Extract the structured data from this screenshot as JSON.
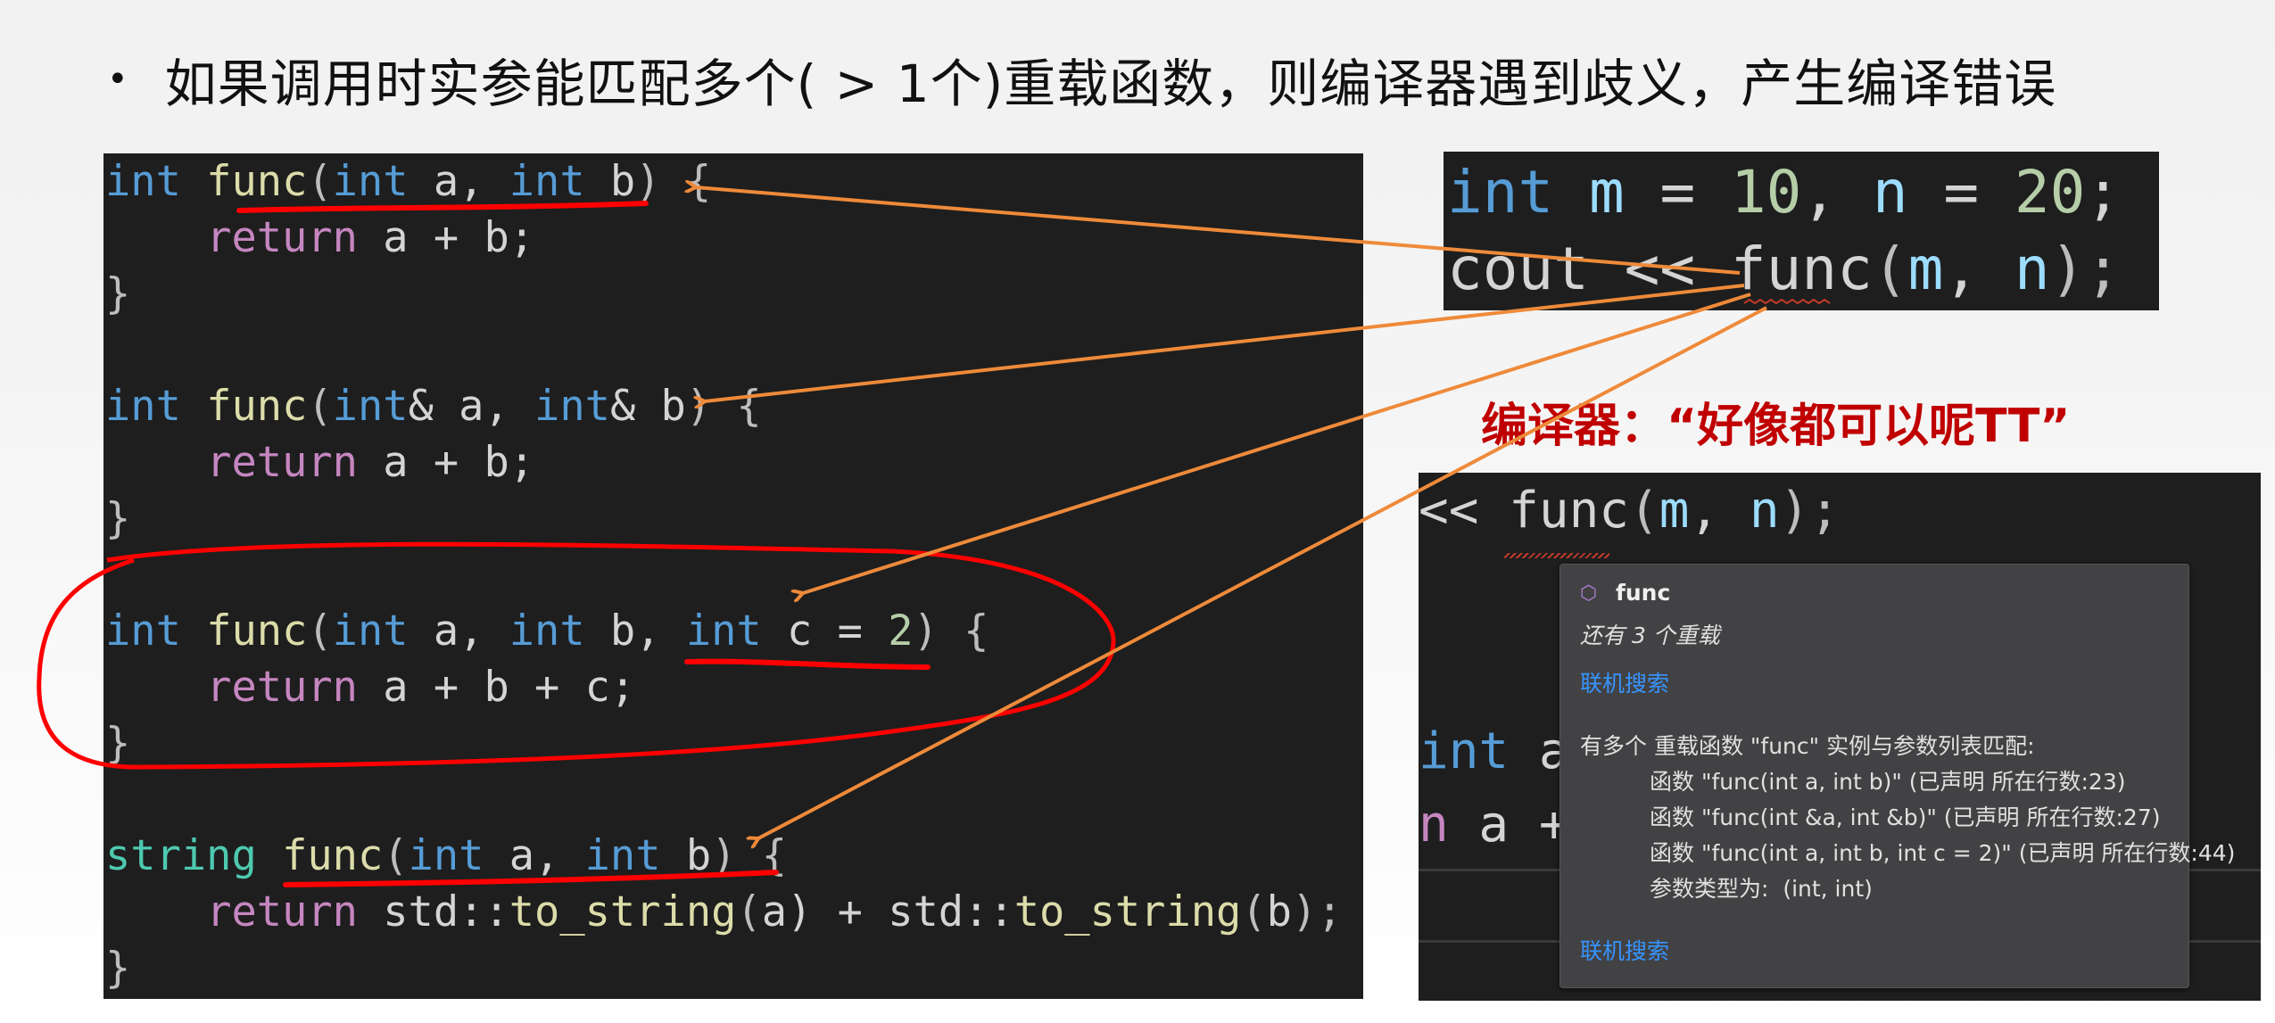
{
  "heading": {
    "bullet": "•",
    "text": "如果调用时实参能匹配多个( > 1个)重载函数，则编译器遇到歧义，产生编译错误"
  },
  "main_code": {
    "lines": [
      [
        {
          "t": "int",
          "c": "kw"
        },
        {
          "t": " ",
          "c": "pl"
        },
        {
          "t": "func",
          "c": "fn"
        },
        {
          "t": "(",
          "c": "pr"
        },
        {
          "t": "int",
          "c": "kw"
        },
        {
          "t": " a, ",
          "c": "pl"
        },
        {
          "t": "int",
          "c": "kw"
        },
        {
          "t": " b",
          "c": "pl"
        },
        {
          "t": ") {",
          "c": "pr"
        }
      ],
      [
        {
          "t": "    ",
          "c": "pl"
        },
        {
          "t": "return",
          "c": "ret"
        },
        {
          "t": " a + b;",
          "c": "pl"
        }
      ],
      [
        {
          "t": "}",
          "c": "pr"
        }
      ],
      [
        {
          "t": "",
          "c": "pl"
        }
      ],
      [
        {
          "t": "int",
          "c": "kw"
        },
        {
          "t": " ",
          "c": "pl"
        },
        {
          "t": "func",
          "c": "fn"
        },
        {
          "t": "(",
          "c": "pr"
        },
        {
          "t": "int",
          "c": "kw"
        },
        {
          "t": "& a, ",
          "c": "pl"
        },
        {
          "t": "int",
          "c": "kw"
        },
        {
          "t": "& b",
          "c": "pl"
        },
        {
          "t": ") {",
          "c": "pr"
        }
      ],
      [
        {
          "t": "    ",
          "c": "pl"
        },
        {
          "t": "return",
          "c": "ret"
        },
        {
          "t": " a + b;",
          "c": "pl"
        }
      ],
      [
        {
          "t": "}",
          "c": "pr"
        }
      ],
      [
        {
          "t": "",
          "c": "pl"
        }
      ],
      [
        {
          "t": "int",
          "c": "kw"
        },
        {
          "t": " ",
          "c": "pl"
        },
        {
          "t": "func",
          "c": "fn"
        },
        {
          "t": "(",
          "c": "pr"
        },
        {
          "t": "int",
          "c": "kw"
        },
        {
          "t": " a, ",
          "c": "pl"
        },
        {
          "t": "int",
          "c": "kw"
        },
        {
          "t": " b, ",
          "c": "pl"
        },
        {
          "t": "int",
          "c": "kw"
        },
        {
          "t": " c = ",
          "c": "pl"
        },
        {
          "t": "2",
          "c": "num"
        },
        {
          "t": ") {",
          "c": "pr"
        }
      ],
      [
        {
          "t": "    ",
          "c": "pl"
        },
        {
          "t": "return",
          "c": "ret"
        },
        {
          "t": " a + b + c;",
          "c": "pl"
        }
      ],
      [
        {
          "t": "}",
          "c": "pr"
        }
      ],
      [
        {
          "t": "",
          "c": "pl"
        }
      ],
      [
        {
          "t": "string",
          "c": "ty"
        },
        {
          "t": " ",
          "c": "pl"
        },
        {
          "t": "func",
          "c": "fn"
        },
        {
          "t": "(",
          "c": "pr"
        },
        {
          "t": "int",
          "c": "kw"
        },
        {
          "t": " a, ",
          "c": "pl"
        },
        {
          "t": "int",
          "c": "kw"
        },
        {
          "t": " b",
          "c": "pl"
        },
        {
          "t": ") {",
          "c": "pr"
        }
      ],
      [
        {
          "t": "    ",
          "c": "pl"
        },
        {
          "t": "return",
          "c": "ret"
        },
        {
          "t": " std::",
          "c": "pl"
        },
        {
          "t": "to_string",
          "c": "fn"
        },
        {
          "t": "(",
          "c": "pr"
        },
        {
          "t": "a",
          "c": "pl"
        },
        {
          "t": ") + std::",
          "c": "pl"
        },
        {
          "t": "to_string",
          "c": "fn"
        },
        {
          "t": "(",
          "c": "pr"
        },
        {
          "t": "b",
          "c": "pl"
        },
        {
          "t": ");",
          "c": "pr"
        }
      ],
      [
        {
          "t": "}",
          "c": "pr"
        }
      ]
    ]
  },
  "call_code": {
    "lines": [
      [
        {
          "t": "int",
          "c": "kw"
        },
        {
          "t": " ",
          "c": "pl"
        },
        {
          "t": "m",
          "c": "var"
        },
        {
          "t": " = ",
          "c": "pl"
        },
        {
          "t": "10",
          "c": "num"
        },
        {
          "t": ", ",
          "c": "pl"
        },
        {
          "t": "n",
          "c": "var"
        },
        {
          "t": " = ",
          "c": "pl"
        },
        {
          "t": "20",
          "c": "num"
        },
        {
          "t": ";",
          "c": "pl"
        }
      ],
      [
        {
          "t": "cout << ",
          "c": "pl"
        },
        {
          "t": "func",
          "c": "pl"
        },
        {
          "t": "(",
          "c": "pr"
        },
        {
          "t": "m",
          "c": "var"
        },
        {
          "t": ", ",
          "c": "pl"
        },
        {
          "t": "n",
          "c": "var"
        },
        {
          "t": ");",
          "c": "pr"
        }
      ]
    ]
  },
  "compiler_note": "编译器：“好像都可以呢TT”",
  "ide_panel": {
    "line1": [
      {
        "t": "<< ",
        "c": "pl"
      },
      {
        "t": "func",
        "c": "pl"
      },
      {
        "t": "(",
        "c": "pr"
      },
      {
        "t": "m",
        "c": "var"
      },
      {
        "t": ", ",
        "c": "pl"
      },
      {
        "t": "n",
        "c": "var"
      },
      {
        "t": ");",
        "c": "pr"
      }
    ],
    "line2": [
      {
        "t": "int",
        "c": "kw"
      },
      {
        "t": " a",
        "c": "pl"
      }
    ],
    "line3": [
      {
        "t": "n",
        "c": "ret"
      },
      {
        "t": " a +",
        "c": "pl"
      }
    ]
  },
  "hover_popup": {
    "symbol_icon": "function-symbol-icon",
    "symbol_name": "func",
    "overload_count": "还有 3 个重载",
    "search_online": "联机搜索",
    "error_message": "有多个 重载函数 \"func\" 实例与参数列表匹配:",
    "candidates": [
      "函数 \"func(int a, int b)\" (已声明 所在行数:23)",
      "函数 \"func(int &a, int &b)\" (已声明 所在行数:27)",
      "函数 \"func(int a, int b, int c = 2)\" (已声明 所在行数:44)"
    ],
    "arg_types": "参数类型为:  (int, int)",
    "search_online_bottom": "联机搜索"
  },
  "annotation_colors": {
    "arrow": "#ee8a3a",
    "red_pen": "#ff0000",
    "note_text": "#c00000"
  }
}
